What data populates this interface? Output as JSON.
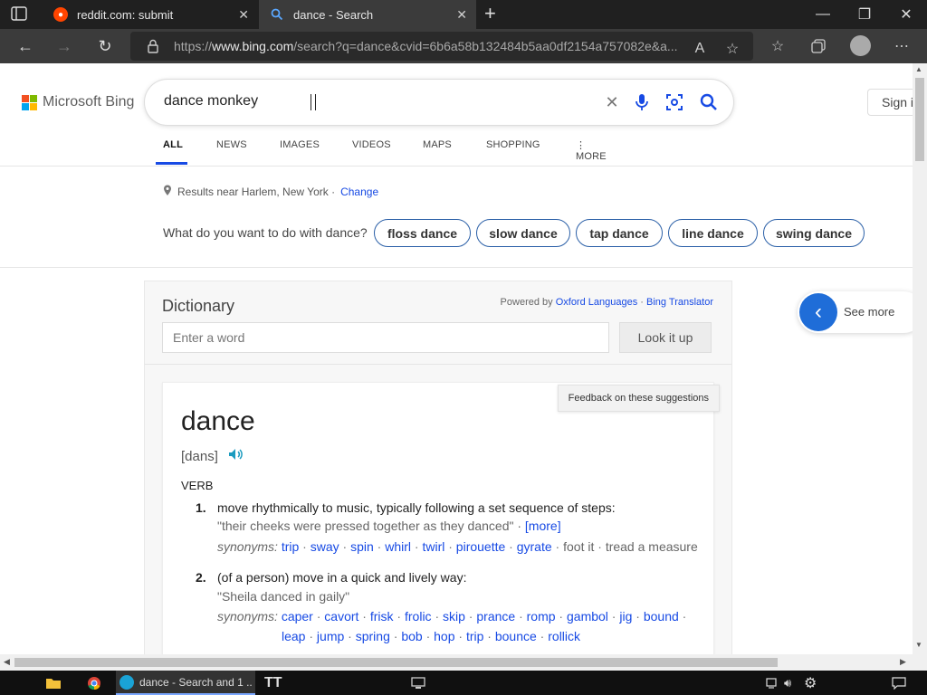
{
  "browser": {
    "tabs": [
      {
        "title": "reddit.com: submit"
      },
      {
        "title": "dance - Search"
      }
    ],
    "url_prefix": "https://",
    "url_domain": "www.bing.com",
    "url_rest": "/search?q=dance&cvid=6b6a58b132484b5aa0df2154a757082e&a..."
  },
  "header": {
    "logo_text": "Microsoft Bing",
    "search_query": "dance monkey",
    "sign_in": "Sign in"
  },
  "nav_tabs": [
    "ALL",
    "NEWS",
    "IMAGES",
    "VIDEOS",
    "MAPS",
    "SHOPPING",
    "MORE"
  ],
  "location": {
    "text": "Results near Harlem, New York ·",
    "change": "Change"
  },
  "intent": {
    "question": "What do you want to do with dance?",
    "pills": [
      "floss dance",
      "slow dance",
      "tap dance",
      "line dance",
      "swing dance"
    ]
  },
  "dictionary": {
    "title": "Dictionary",
    "powered_by": "Powered by",
    "oxford": "Oxford Languages",
    "sep": "·",
    "translator": "Bing Translator",
    "input_placeholder": "Enter a word",
    "lookup_button": "Look it up",
    "feedback": "Feedback on these suggestions",
    "word": "dance",
    "pronunciation": "[dans]",
    "part_of_speech": "VERB",
    "synonyms_label": "synonyms:",
    "senses": [
      {
        "num": "1.",
        "definition": "move rhythmically to music, typically following a set sequence of steps:",
        "example": "\"their cheeks were pressed together as they danced\" ·",
        "more": "[more]",
        "synonyms": [
          "trip",
          "sway",
          "spin",
          "whirl",
          "twirl",
          "pirouette",
          "gyrate"
        ],
        "synonyms_plain": [
          "foot it",
          "tread a measure"
        ]
      },
      {
        "num": "2.",
        "definition": "(of a person) move in a quick and lively way:",
        "example": "\"Sheila danced in gaily\"",
        "synonyms": [
          "caper",
          "cavort",
          "frisk",
          "frolic",
          "skip",
          "prance",
          "romp",
          "gambol",
          "jig",
          "bound",
          "leap",
          "jump",
          "spring",
          "bob",
          "hop",
          "trip",
          "bounce",
          "rollick"
        ]
      }
    ]
  },
  "see_more": "See more",
  "taskbar": {
    "edge_label": "dance - Search and 1 ..."
  },
  "colors": {
    "bing_blue": "#174ae4",
    "ms_red": "#f25022",
    "ms_green": "#7fba00",
    "ms_blue": "#00a4ef",
    "ms_yellow": "#ffb900"
  }
}
